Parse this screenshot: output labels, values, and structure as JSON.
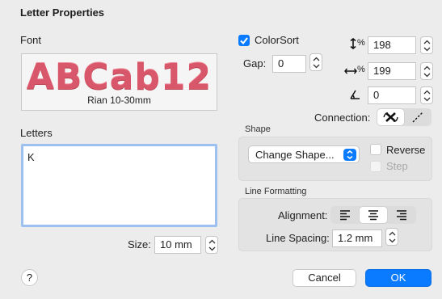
{
  "dialog": {
    "title": "Letter Properties"
  },
  "font": {
    "section_label": "Font",
    "preview_text": "ABCab12",
    "font_name": "Rian 10-30mm"
  },
  "letters": {
    "section_label": "Letters",
    "value": "K",
    "size_label": "Size:",
    "size_value": "10 mm"
  },
  "colorsort": {
    "label": "ColorSort",
    "checked": true
  },
  "gap": {
    "label": "Gap:",
    "value": "0"
  },
  "vertical_scale": {
    "unit": "%",
    "value": "198"
  },
  "horizontal_scale": {
    "unit": "%",
    "value": "199"
  },
  "angle": {
    "value": "0"
  },
  "connection": {
    "label": "Connection:"
  },
  "shape": {
    "group_label": "Shape",
    "popup_value": "Change Shape...",
    "reverse_label": "Reverse",
    "step_label": "Step"
  },
  "line_formatting": {
    "group_label": "Line Formatting",
    "alignment_label": "Alignment:",
    "alignment_selected": "center",
    "line_spacing_label": "Line Spacing:",
    "line_spacing_value": "1.2 mm"
  },
  "buttons": {
    "help": "?",
    "cancel": "Cancel",
    "ok": "OK"
  },
  "colors": {
    "accent": "#0a7bff",
    "preview_text": "#d9576a",
    "focus_ring": "#9cc0f0"
  }
}
